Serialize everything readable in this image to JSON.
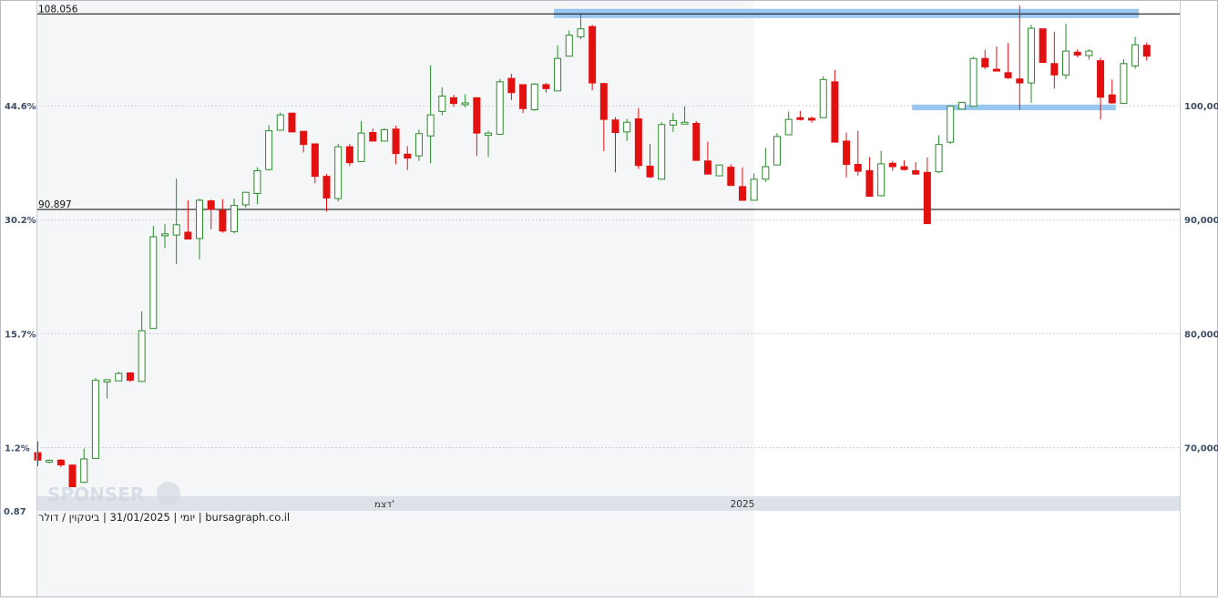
{
  "chart_data": {
    "type": "candlestick",
    "source_label": "יומי | 31/01/2025 | ביטקוין / דולר | bursagraph.co.il",
    "watermark_text": "SPONSER",
    "y_axis_right": {
      "ticks": [
        {
          "value": 70000,
          "label": "70,000"
        },
        {
          "value": 80000,
          "label": "80,000"
        },
        {
          "value": 90000,
          "label": "90,000"
        },
        {
          "value": 100000,
          "label": "100,000"
        }
      ],
      "range": [
        65800,
        108800
      ]
    },
    "y_axis_left_percent": {
      "ticks": [
        {
          "value": 70000,
          "label": "1.2%"
        },
        {
          "value": 80000,
          "label": "15.7%"
        },
        {
          "value": 90000,
          "label": "30.2%"
        },
        {
          "value": 100000,
          "label": "44.6%"
        }
      ],
      "bottom_label": "0.87"
    },
    "x_axis": {
      "labels": [
        {
          "index": 30,
          "label": "דצמ'"
        },
        {
          "index": 61,
          "label": "2025"
        }
      ],
      "shaded_until_index": 62
    },
    "reference_lines": [
      {
        "value": 108056,
        "label": "108.056"
      },
      {
        "value": 90897,
        "label": "90.897"
      }
    ],
    "zones": [
      {
        "from_index": 45,
        "to_index": 95,
        "low": 107700,
        "high": 108500
      },
      {
        "from_index": 76,
        "to_index": 93,
        "low": 99600,
        "high": 100100
      }
    ],
    "up_color": "#2a8a2a",
    "down_color": "#e31010",
    "candles": [
      [
        69550,
        70540,
        68360,
        68900
      ],
      [
        68740,
        68960,
        68620,
        68880
      ],
      [
        68890,
        69000,
        68290,
        68470
      ],
      [
        68460,
        68440,
        66560,
        66560
      ],
      [
        66950,
        69900,
        66890,
        69000
      ],
      [
        69050,
        76100,
        69600,
        75900
      ],
      [
        75750,
        76000,
        74300,
        75950
      ],
      [
        75850,
        76650,
        75900,
        76500
      ],
      [
        76550,
        76500,
        75750,
        75900
      ],
      [
        75800,
        81950,
        75850,
        80250
      ],
      [
        80450,
        89450,
        80750,
        88500
      ],
      [
        88600,
        89600,
        87500,
        88750
      ],
      [
        88650,
        93600,
        86100,
        89550
      ],
      [
        88900,
        91700,
        88650,
        88300
      ],
      [
        88350,
        91850,
        86500,
        91700
      ],
      [
        91650,
        91750,
        89150,
        90900
      ],
      [
        90800,
        91800,
        88850,
        89000
      ],
      [
        88950,
        91850,
        88800,
        91250
      ],
      [
        91300,
        91900,
        91050,
        92400
      ],
      [
        92300,
        94600,
        91350,
        94300
      ],
      [
        94400,
        98300,
        94300,
        97800
      ],
      [
        97850,
        99400,
        98150,
        99200
      ],
      [
        99350,
        99300,
        97800,
        97700
      ],
      [
        97750,
        97700,
        95900,
        96600
      ],
      [
        96650,
        96700,
        93200,
        93800
      ],
      [
        93800,
        94000,
        90700,
        91900
      ],
      [
        91850,
        96650,
        91600,
        96400
      ],
      [
        96400,
        96650,
        94700,
        95000
      ],
      [
        95100,
        98650,
        95300,
        97600
      ],
      [
        97650,
        98000,
        96850,
        96900
      ],
      [
        96900,
        98000,
        96900,
        97900
      ],
      [
        97950,
        98250,
        94850,
        95800
      ],
      [
        95750,
        96450,
        94350,
        95400
      ],
      [
        95600,
        97900,
        95150,
        97550
      ],
      [
        97350,
        103550,
        94950,
        99200
      ],
      [
        99500,
        101600,
        99150,
        100850
      ],
      [
        100700,
        100950,
        99900,
        100200
      ],
      [
        100250,
        101000,
        99850,
        100250
      ],
      [
        100700,
        100750,
        95600,
        97600
      ],
      [
        97400,
        97800,
        95500,
        97600
      ],
      [
        97500,
        102350,
        97600,
        102100
      ],
      [
        102400,
        102800,
        100500,
        101150
      ],
      [
        101850,
        101850,
        99350,
        99750
      ],
      [
        99650,
        102000,
        99550,
        101900
      ],
      [
        101850,
        102000,
        101150,
        101500
      ],
      [
        101300,
        105300,
        101350,
        104150
      ],
      [
        104350,
        106600,
        104500,
        106200
      ],
      [
        106050,
        108000,
        105850,
        106750
      ],
      [
        106950,
        107100,
        101350,
        102000
      ],
      [
        101950,
        102000,
        96000,
        98800
      ],
      [
        98750,
        99000,
        94150,
        97650
      ],
      [
        97700,
        98850,
        96900,
        98550
      ],
      [
        98850,
        99800,
        94450,
        94750
      ],
      [
        94700,
        96650,
        93650,
        93750
      ],
      [
        93550,
        98550,
        93650,
        98350
      ],
      [
        98300,
        99350,
        97700,
        98700
      ],
      [
        98500,
        99950,
        98450,
        98550
      ],
      [
        98450,
        98650,
        95350,
        95200
      ],
      [
        95150,
        96850,
        94500,
        94000
      ],
      [
        93850,
        94850,
        94000,
        94800
      ],
      [
        94600,
        94850,
        93150,
        93000
      ],
      [
        92900,
        94600,
        92250,
        91700
      ],
      [
        91700,
        94050,
        91800,
        93550
      ],
      [
        93550,
        96300,
        93300,
        94650
      ],
      [
        94800,
        97600,
        95200,
        97300
      ],
      [
        97450,
        99500,
        97500,
        98800
      ],
      [
        98950,
        99550,
        98700,
        98900
      ],
      [
        98900,
        99050,
        98500,
        98850
      ],
      [
        98950,
        102600,
        99050,
        102300
      ],
      [
        102100,
        103150,
        96900,
        96800
      ],
      [
        96900,
        97650,
        93700,
        94850
      ],
      [
        94850,
        97800,
        93850,
        94250
      ],
      [
        94300,
        95500,
        92300,
        92050
      ],
      [
        92100,
        96050,
        92050,
        94900
      ],
      [
        94950,
        95150,
        94300,
        94650
      ],
      [
        94650,
        95200,
        94300,
        94400
      ],
      [
        94300,
        95050,
        93950,
        94000
      ],
      [
        94150,
        95450,
        93000,
        89650
      ],
      [
        94200,
        97400,
        94100,
        96600
      ],
      [
        96800,
        99400,
        96650,
        99950
      ],
      [
        99700,
        100200,
        100000,
        100300
      ],
      [
        99950,
        104300,
        100100,
        104150
      ],
      [
        104150,
        104900,
        103200,
        103400
      ],
      [
        103200,
        105200,
        103150,
        103150
      ],
      [
        102900,
        105500,
        102350,
        102450
      ],
      [
        102350,
        108800,
        99650,
        102000
      ],
      [
        102000,
        107100,
        100250,
        106800
      ],
      [
        106750,
        106700,
        103850,
        103800
      ],
      [
        103700,
        106500,
        101500,
        102700
      ],
      [
        102700,
        107200,
        102350,
        104800
      ],
      [
        104700,
        104950,
        104250,
        104450
      ],
      [
        104400,
        104950,
        104050,
        104800
      ],
      [
        103950,
        104200,
        98800,
        100750
      ],
      [
        100950,
        102300,
        100150,
        100250
      ],
      [
        100200,
        104100,
        100250,
        103700
      ],
      [
        103500,
        106050,
        103250,
        105350
      ],
      [
        105300,
        105550,
        103950,
        104350
      ]
    ]
  }
}
